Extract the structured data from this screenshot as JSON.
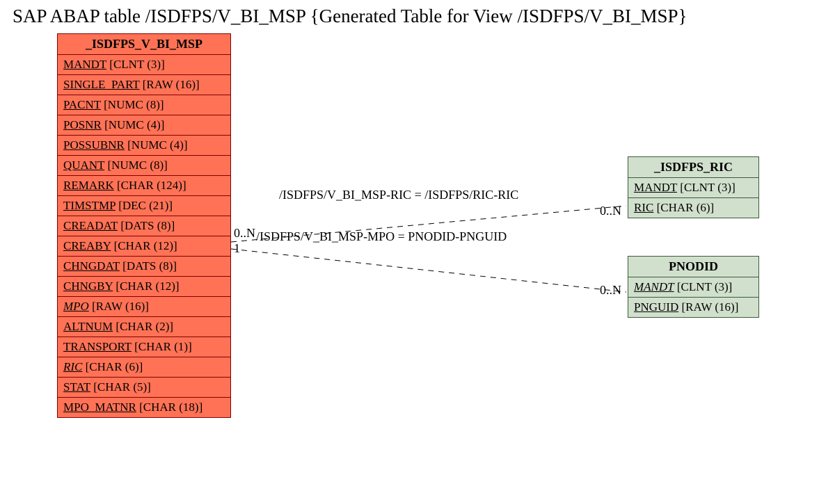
{
  "title": "SAP ABAP table /ISDFPS/V_BI_MSP {Generated Table for View /ISDFPS/V_BI_MSP}",
  "main_table": {
    "name": "_ISDFPS_V_BI_MSP",
    "fields": [
      {
        "name": "MANDT",
        "type": "[CLNT (3)]",
        "italic": false
      },
      {
        "name": "SINGLE_PART",
        "type": "[RAW (16)]",
        "italic": false
      },
      {
        "name": "PACNT",
        "type": "[NUMC (8)]",
        "italic": false
      },
      {
        "name": "POSNR",
        "type": "[NUMC (4)]",
        "italic": false
      },
      {
        "name": "POSSUBNR",
        "type": "[NUMC (4)]",
        "italic": false
      },
      {
        "name": "QUANT",
        "type": "[NUMC (8)]",
        "italic": false
      },
      {
        "name": "REMARK",
        "type": "[CHAR (124)]",
        "italic": false
      },
      {
        "name": "TIMSTMP",
        "type": "[DEC (21)]",
        "italic": false
      },
      {
        "name": "CREADAT",
        "type": "[DATS (8)]",
        "italic": false
      },
      {
        "name": "CREABY",
        "type": "[CHAR (12)]",
        "italic": false
      },
      {
        "name": "CHNGDAT",
        "type": "[DATS (8)]",
        "italic": false
      },
      {
        "name": "CHNGBY",
        "type": "[CHAR (12)]",
        "italic": false
      },
      {
        "name": "MPO",
        "type": "[RAW (16)]",
        "italic": true
      },
      {
        "name": "ALTNUM",
        "type": "[CHAR (2)]",
        "italic": false
      },
      {
        "name": "TRANSPORT",
        "type": "[CHAR (1)]",
        "italic": false
      },
      {
        "name": "RIC",
        "type": "[CHAR (6)]",
        "italic": true
      },
      {
        "name": "STAT",
        "type": "[CHAR (5)]",
        "italic": false
      },
      {
        "name": "MPO_MATNR",
        "type": "[CHAR (18)]",
        "italic": false
      }
    ]
  },
  "ric_table": {
    "name": "_ISDFPS_RIC",
    "fields": [
      {
        "name": "MANDT",
        "type": "[CLNT (3)]",
        "italic": false
      },
      {
        "name": "RIC",
        "type": "[CHAR (6)]",
        "italic": false
      }
    ]
  },
  "pnodid_table": {
    "name": "PNODID",
    "fields": [
      {
        "name": "MANDT",
        "type": "[CLNT (3)]",
        "italic": true
      },
      {
        "name": "PNGUID",
        "type": "[RAW (16)]",
        "italic": false
      }
    ]
  },
  "relations": {
    "r1": "/ISDFPS/V_BI_MSP-RIC = /ISDFPS/RIC-RIC",
    "r2": "/ISDFPS/V_BI_MSP-MPO = PNODID-PNGUID"
  },
  "cardinalities": {
    "left_top": "0..N",
    "left_bottom": "1",
    "right_ric": "0..N",
    "right_pnodid": "0..N"
  }
}
